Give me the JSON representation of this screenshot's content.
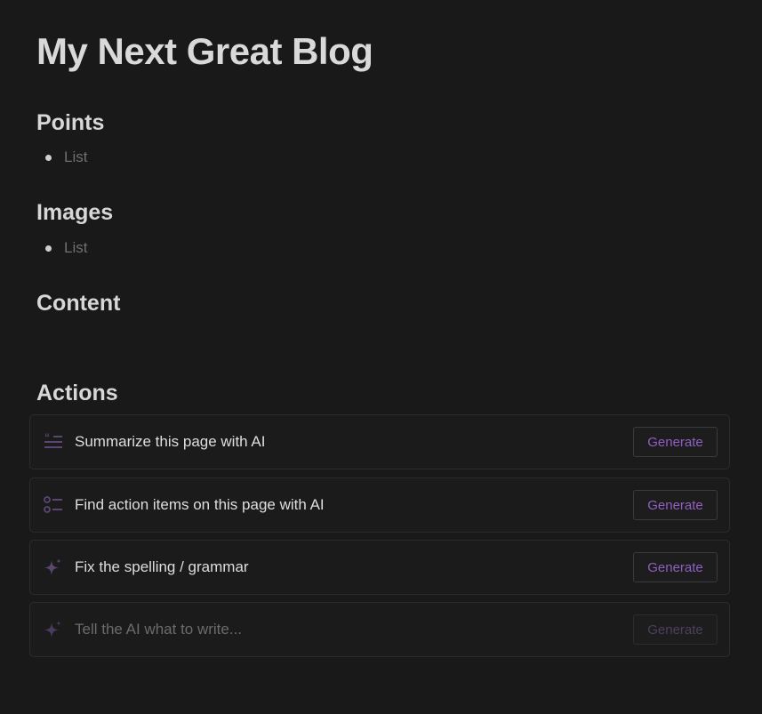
{
  "page": {
    "title": "My Next Great Blog"
  },
  "sections": {
    "points": {
      "heading": "Points",
      "items": [
        "List"
      ]
    },
    "images": {
      "heading": "Images",
      "items": [
        "List"
      ]
    },
    "content": {
      "heading": "Content"
    },
    "actions": {
      "heading": "Actions"
    }
  },
  "actions": [
    {
      "icon": "quote-lines-icon",
      "label": "Summarize this page with AI",
      "button": "Generate",
      "enabled": true
    },
    {
      "icon": "checklist-icon",
      "label": "Find action items on this page with AI",
      "button": "Generate",
      "enabled": true
    },
    {
      "icon": "sparkle-icon",
      "label": "Fix the spelling / grammar",
      "button": "Generate",
      "enabled": true
    },
    {
      "icon": "sparkle-icon",
      "placeholder": "Tell the AI what to write...",
      "button": "Generate",
      "enabled": false
    }
  ],
  "colors": {
    "background": "#191919",
    "accent": "#8f5fc2",
    "icon": "#5a4670"
  }
}
